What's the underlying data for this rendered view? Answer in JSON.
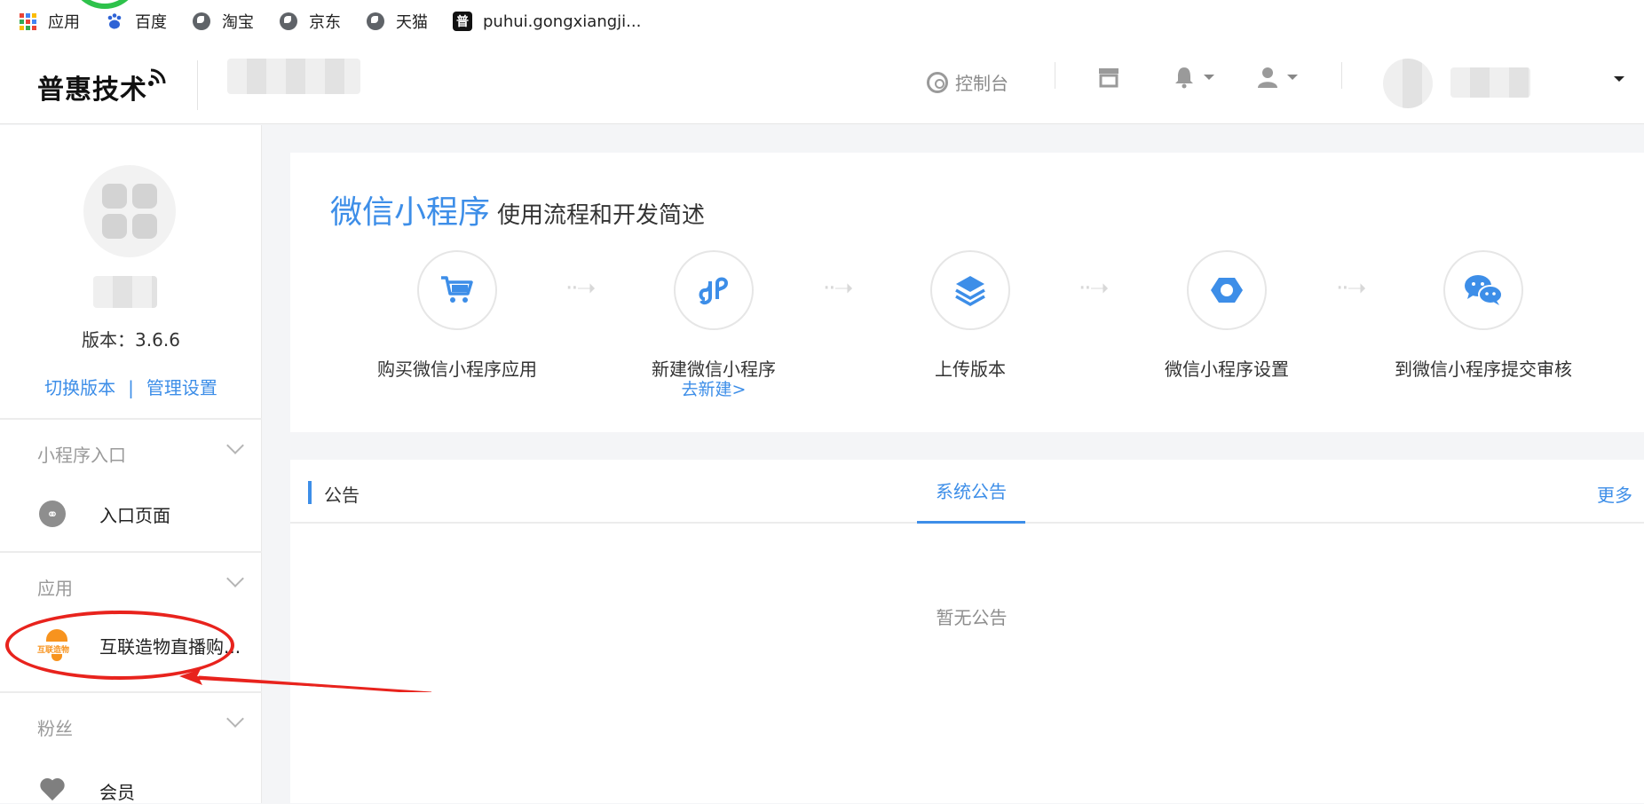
{
  "bookmarks": [
    {
      "label": "应用",
      "icon": "apps-grid-icon"
    },
    {
      "label": "百度",
      "icon": "baidu-paw-icon"
    },
    {
      "label": "淘宝",
      "icon": "globe-icon"
    },
    {
      "label": "京东",
      "icon": "globe-icon"
    },
    {
      "label": "天猫",
      "icon": "globe-icon"
    },
    {
      "label": "puhui.gongxiangji...",
      "icon": "pu-site-icon",
      "icon_char": "普"
    }
  ],
  "header": {
    "logo_text": "普惠技术",
    "console_label": "控制台"
  },
  "sidebar": {
    "version_label": "版本：",
    "version_value": "3.6.6",
    "switch_version": "切换版本",
    "separator": "|",
    "manage_settings": "管理设置",
    "sections": [
      {
        "title": "小程序入口",
        "items": [
          {
            "label": "入口页面",
            "icon": "link-icon"
          }
        ]
      },
      {
        "title": "应用",
        "items": [
          {
            "label": "互联造物直播购...",
            "icon": "app-logo-icon",
            "logo_text": "互联造物"
          }
        ]
      },
      {
        "title": "粉丝",
        "items": [
          {
            "label": "会员",
            "icon": "heart-icon"
          }
        ]
      }
    ]
  },
  "intro": {
    "title_main": "微信小程序",
    "title_sub": "使用流程和开发简述",
    "steps": [
      {
        "label": "购买微信小程序应用",
        "icon": "cart-icon"
      },
      {
        "label": "新建微信小程序",
        "icon": "mini-program-icon",
        "link": "去新建>"
      },
      {
        "label": "上传版本",
        "icon": "layers-icon"
      },
      {
        "label": "微信小程序设置",
        "icon": "hexagon-icon"
      },
      {
        "label": "到微信小程序提交审核",
        "icon": "wechat-icon"
      }
    ]
  },
  "notice": {
    "title": "公告",
    "tab": "系统公告",
    "more": "更多",
    "empty": "暂无公告"
  },
  "colors": {
    "accent": "#3d8ee8",
    "annotation": "#e8231d",
    "app_orange": "#f7931e"
  }
}
